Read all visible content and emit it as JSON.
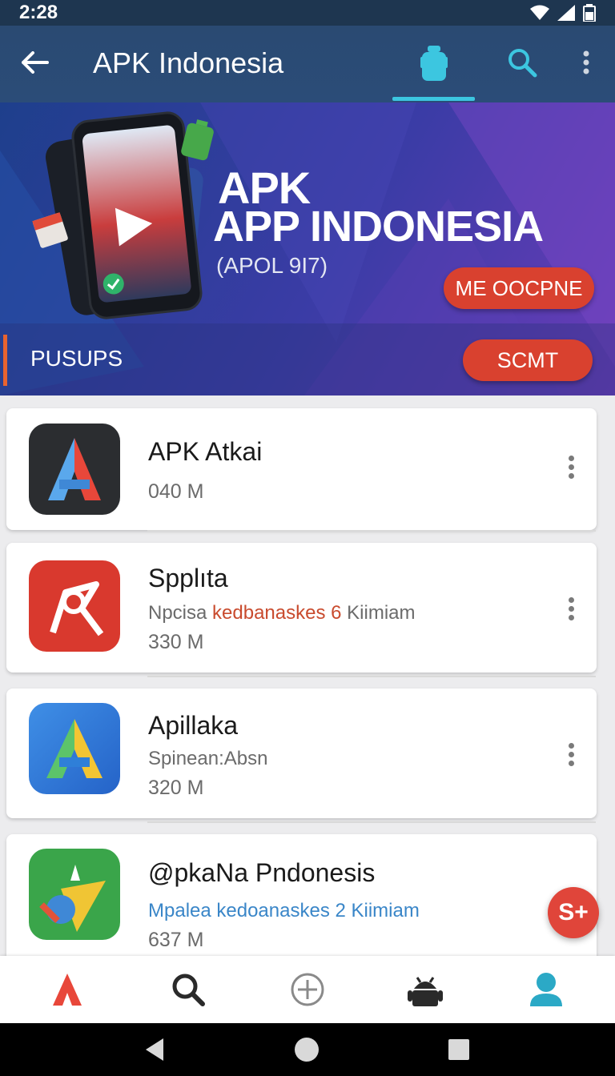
{
  "status_bar": {
    "time": "2:28"
  },
  "app_bar": {
    "title": "APK Indonesia"
  },
  "banner": {
    "title_line1": "APK",
    "title_line2": "APP INDONESIA",
    "subtitle": "(APOL 9I7)",
    "button_primary": "ME OOCPNE",
    "strip_label": "PUSUPS",
    "button_secondary": "SCMT"
  },
  "apps": [
    {
      "name": "APK Atkai",
      "size": "040  M"
    },
    {
      "name": "Spplıta",
      "desc_plain": "Npcisa ",
      "desc_highlight": "kedbanaskes 6",
      "desc_tail": " Kiimiam",
      "size": "330  M"
    },
    {
      "name": "Apillaka",
      "desc_plain": "Spinean:Absn",
      "size": "320  M"
    },
    {
      "name": "@pkaNa Pndonesis",
      "desc_highlight": "Mpalea kedoanaskes 2 Kiimiam",
      "size": "637  M"
    }
  ],
  "fab": {
    "label": "S+"
  },
  "colors": {
    "app_bar": "#2a4a72",
    "accent": "#3cc6e0",
    "red": "#d9412f"
  }
}
